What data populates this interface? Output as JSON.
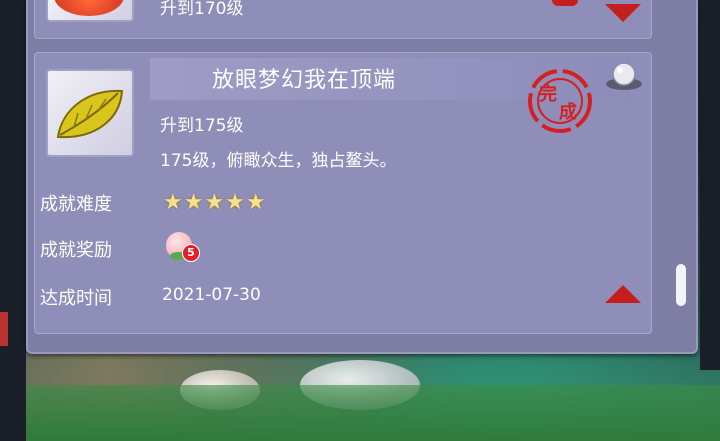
{
  "previous_entry": {
    "subtitle": "升到170级"
  },
  "achievement": {
    "title": "放眼梦幻我在顶端",
    "requirement": "升到175级",
    "description": "175级，俯瞰众生，独占鳌头。",
    "difficulty_label": "成就难度",
    "difficulty_stars": "★★★★★",
    "difficulty_rating": 5,
    "reward_label": "成就奖励",
    "reward_count": "5",
    "time_label": "达成时间",
    "date": "2021-07-30",
    "stamp_text_1": "完",
    "stamp_text_2": "成"
  },
  "colors": {
    "panel": "#7e7da4",
    "card": "#8f8eb8",
    "arrow": "#c41e1e",
    "stamp": "#d42020",
    "star": "#f7e08a"
  }
}
